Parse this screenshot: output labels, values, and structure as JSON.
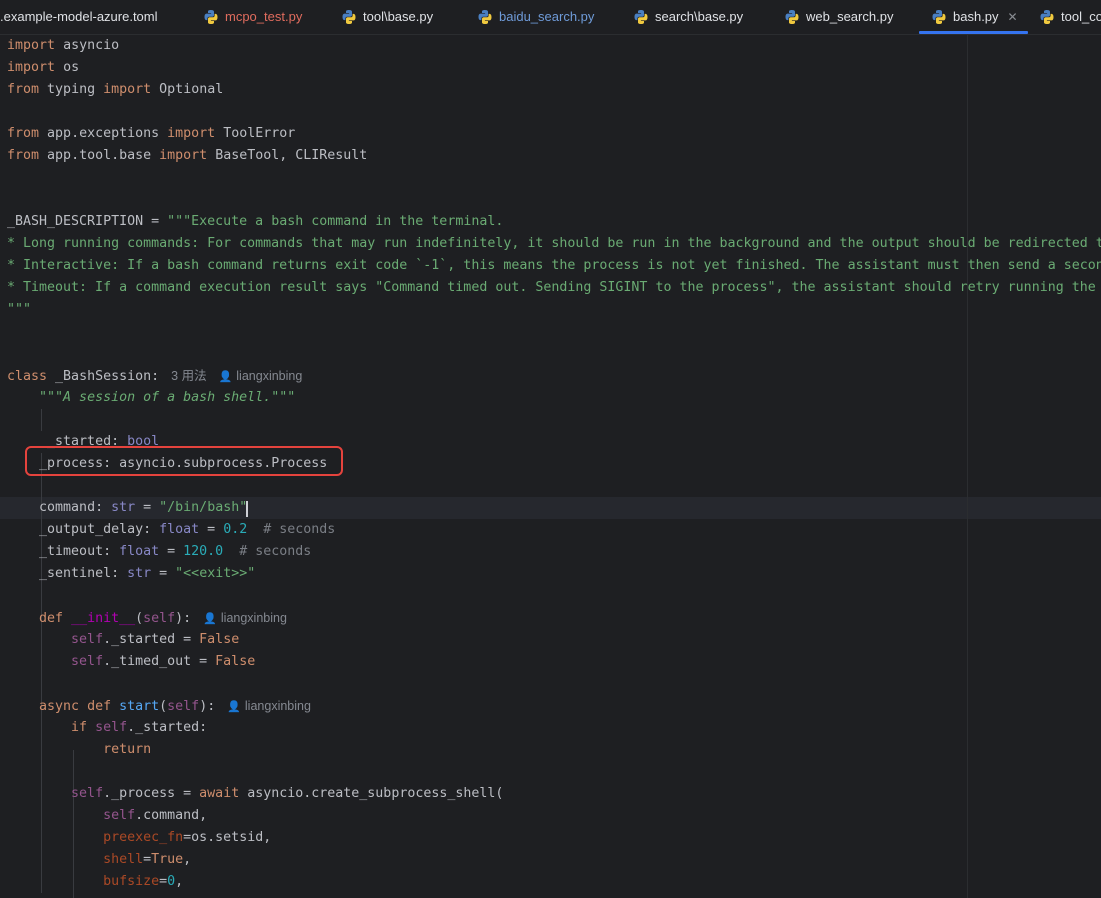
{
  "tabs": [
    {
      "label": ".example-model-azure.toml",
      "icon": "toml-file-icon",
      "state": "normal"
    },
    {
      "label": "mcpo_test.py",
      "icon": "python-file-icon",
      "state": "modified"
    },
    {
      "label": "tool\\base.py",
      "icon": "python-file-icon",
      "state": "normal"
    },
    {
      "label": "baidu_search.py",
      "icon": "python-file-icon",
      "state": "linked"
    },
    {
      "label": "search\\base.py",
      "icon": "python-file-icon",
      "state": "normal"
    },
    {
      "label": "web_search.py",
      "icon": "python-file-icon",
      "state": "normal"
    },
    {
      "label": "bash.py",
      "icon": "python-file-icon",
      "state": "active"
    },
    {
      "label": "tool_co",
      "icon": "python-file-icon",
      "state": "normal"
    }
  ],
  "colors": {
    "background": "#1e1f22",
    "keyword": "#cf8e6d",
    "string": "#6aab73",
    "number": "#2aacb8",
    "self": "#94558d",
    "function": "#56a8f5",
    "highlight_box": "#e5433d",
    "active_tab_underline": "#3574f0"
  },
  "hints": {
    "usages": "3 用法",
    "author": "liangxinbing"
  },
  "code": {
    "l1": "asyncio",
    "l2": "os",
    "l3_mod": "typing",
    "l3_name": "Optional",
    "l5_mod": "app.exceptions",
    "l5_name": "ToolError",
    "l6_mod": "app.tool.base",
    "l6_name": "BaseTool, CLIResult",
    "l9_var": "_BASH_DESCRIPTION",
    "l9_str": "\"\"\"Execute a bash command in the terminal.",
    "l10": "* Long running commands: For commands that may run indefinitely, it should be run in the background and the output should be redirected t",
    "l11": "* Interactive: If a bash command returns exit code `-1`, this means the process is not yet finished. The assistant must then send a secon",
    "l12": "* Timeout: If a command execution result says \"Command timed out. Sending SIGINT to the process\", the assistant should retry running the",
    "l13": "\"\"\"",
    "l16_class": "_BashSession",
    "l17_doc": "\"\"\"A session of a bash shell.\"\"\"",
    "l19_attr": "_started",
    "l19_type": "bool",
    "l20_attr": "_process",
    "l20_type": "asyncio.subprocess.Process",
    "l22_attr": "command",
    "l22_type": "str",
    "l22_val": "\"/bin/bash\"",
    "l23_attr": "_output_delay",
    "l23_type": "float",
    "l23_val": "0.2",
    "l23_cmt": "# seconds",
    "l24_attr": "_timeout",
    "l24_type": "float",
    "l24_val": "120.0",
    "l24_cmt": "# seconds",
    "l25_attr": "_sentinel",
    "l25_type": "str",
    "l25_val": "\"<<exit>>\"",
    "l27_fn": "__init__",
    "l28_attr": "._started",
    "l28_val": "False",
    "l29_attr": "._timed_out",
    "l29_val": "False",
    "l31_fn": "start",
    "l32_attr": "._started:",
    "l33": "return",
    "l35_attr": "._process",
    "l35_call": "asyncio.create_subprocess_shell(",
    "l36_attr": ".command,",
    "l37_param": "preexec_fn",
    "l37_val": "os.setsid,",
    "l38_param": "shell",
    "l38_val": "True",
    "l39_param": "bufsize",
    "l39_val": "0"
  }
}
